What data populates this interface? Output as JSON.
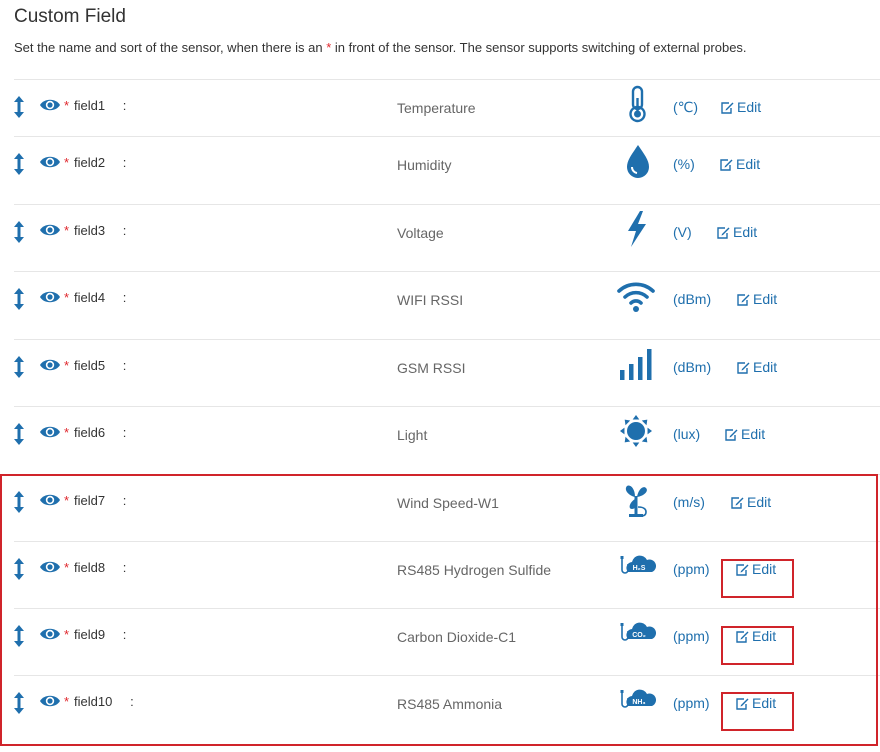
{
  "header": {
    "title": "Custom Field",
    "desc_before": "Set the name and sort of the sensor, when there is an ",
    "desc_star": "*",
    "desc_after": " in front of the sensor. The sensor supports switching of external probes."
  },
  "colors": {
    "accent": "#1f6fad",
    "star": "#e0262c",
    "highlight": "#d0242a"
  },
  "rows": [
    {
      "star": "*",
      "field": "field1",
      "colon": ":",
      "sensor": "Temperature",
      "icon": "thermometer-icon",
      "unit": "(℃)",
      "edit": "Edit"
    },
    {
      "star": "*",
      "field": "field2",
      "colon": ":",
      "sensor": "Humidity",
      "icon": "water-drop-icon",
      "unit": "(%)",
      "edit": "Edit"
    },
    {
      "star": "*",
      "field": "field3",
      "colon": ":",
      "sensor": "Voltage",
      "icon": "lightning-icon",
      "unit": "(V)",
      "edit": "Edit"
    },
    {
      "star": "*",
      "field": "field4",
      "colon": ":",
      "sensor": "WIFI RSSI",
      "icon": "wifi-icon",
      "unit": "(dBm)",
      "edit": "Edit"
    },
    {
      "star": "*",
      "field": "field5",
      "colon": ":",
      "sensor": "GSM RSSI",
      "icon": "signal-bars-icon",
      "unit": "(dBm)",
      "edit": "Edit"
    },
    {
      "star": "*",
      "field": "field6",
      "colon": ":",
      "sensor": "Light",
      "icon": "sun-icon",
      "unit": "(lux)",
      "edit": "Edit"
    },
    {
      "star": "*",
      "field": "field7",
      "colon": ":",
      "sensor": "Wind Speed-W1",
      "icon": "wind-fan-icon",
      "unit": "(m/s)",
      "edit": "Edit"
    },
    {
      "star": "*",
      "field": "field8",
      "colon": ":",
      "sensor": "RS485 Hydrogen Sulfide",
      "icon": "h2s-cloud-icon",
      "icon_text": "H₂S",
      "unit": "(ppm)",
      "edit": "Edit"
    },
    {
      "star": "*",
      "field": "field9",
      "colon": ":",
      "sensor": "Carbon Dioxide-C1",
      "icon": "co2-cloud-icon",
      "icon_text": "CO₂",
      "unit": "(ppm)",
      "edit": "Edit"
    },
    {
      "star": "*",
      "field": "field10",
      "colon": ":",
      "sensor": "RS485 Ammonia",
      "icon": "nh3-cloud-icon",
      "icon_text": "NH₃",
      "unit": "(ppm)",
      "edit": "Edit"
    }
  ]
}
